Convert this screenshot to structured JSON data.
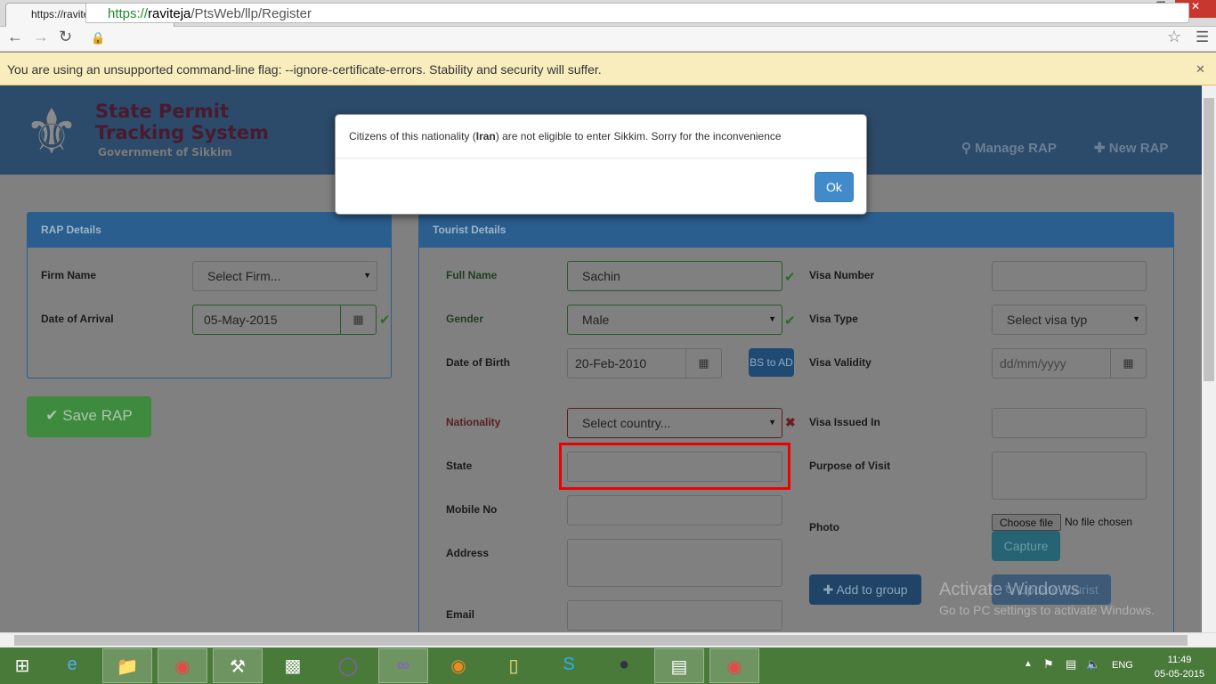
{
  "browser": {
    "tab_title": "https://raviteja/PtsWeb/llp",
    "url_scheme": "https://",
    "url_host": "raviteja",
    "url_path": "/PtsWeb/llp/Register",
    "infobar": "You are using an unsupported command-line flag: --ignore-certificate-errors. Stability and security will suffer."
  },
  "header": {
    "title_line1": "State Permit",
    "title_line2": "Tracking System",
    "subtitle": "Government of Sikkim",
    "nav": [
      {
        "label": "Manage RAP",
        "icon": "search-icon"
      },
      {
        "label": "New RAP",
        "icon": "plus-icon"
      }
    ]
  },
  "rap": {
    "title": "RAP Details",
    "firm_label": "Firm Name",
    "firm_value": "Select Firm...",
    "arrival_label": "Date of Arrival",
    "arrival_value": "05-May-2015",
    "save_label": "Save RAP"
  },
  "tourist": {
    "title": "Tourist Details",
    "full_name_label": "Full Name",
    "full_name": "Sachin",
    "gender_label": "Gender",
    "gender": "Male",
    "dob_label": "Date of Birth",
    "dob": "20-Feb-2010",
    "bs_to_ad": "BS to AD",
    "nationality_label": "Nationality",
    "nationality": "Select country...",
    "state_label": "State",
    "state": "",
    "mobile_label": "Mobile No",
    "mobile": "",
    "address_label": "Address",
    "address": "",
    "email_label": "Email",
    "email": "",
    "visa_number_label": "Visa Number",
    "visa_number": "",
    "visa_type_label": "Visa Type",
    "visa_type": "Select visa typ",
    "visa_validity_label": "Visa Validity",
    "visa_validity_placeholder": "dd/mm/yyyy",
    "visa_issued_label": "Visa Issued In",
    "visa_issued": "",
    "purpose_label": "Purpose of Visit",
    "purpose": "",
    "photo_label": "Photo",
    "choose_file": "Choose file",
    "no_file": "No file chosen",
    "capture": "Capture",
    "add_group": "Add to group",
    "update_tourist": "Update Tourist"
  },
  "modal": {
    "text_before": "Citizens of this nationality (",
    "country": "Iran",
    "text_after": ") are not eligible to enter Sikkim. Sorry for the inconvenience",
    "ok": "Ok"
  },
  "watermark": {
    "line1": "Activate Windows",
    "line2": "Go to PC settings to activate Windows."
  },
  "tray": {
    "lang": "ENG",
    "time": "11:49",
    "date": "05-05-2015"
  }
}
